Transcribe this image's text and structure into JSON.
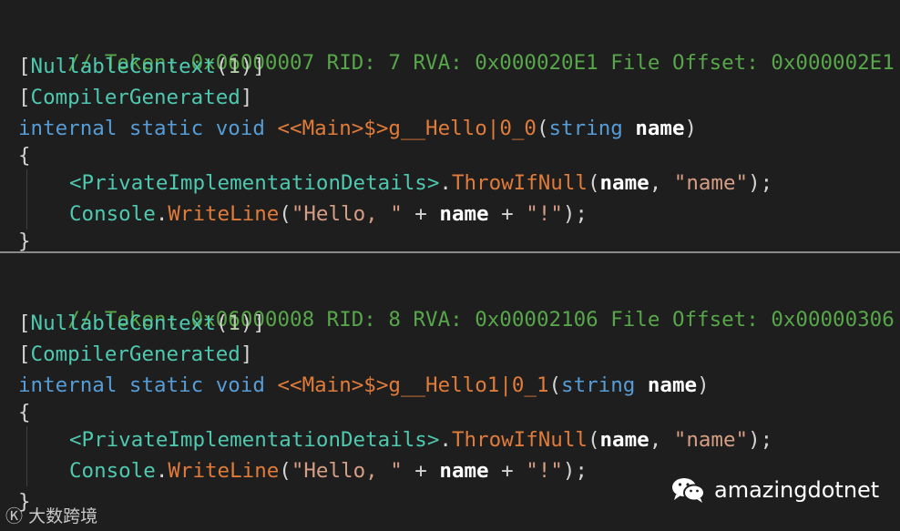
{
  "blocks": [
    {
      "comment": "// Token: 0x06000007 RID: 7 RVA: 0x000020E1 File Offset: 0x000002E1",
      "attr1_open": "[",
      "attr1_name": "NullableContext",
      "attr1_paren_open": "(",
      "attr1_arg": "1",
      "attr1_close": ")]",
      "attr2_open": "[",
      "attr2_name": "CompilerGenerated",
      "attr2_close": "]",
      "kw_internal": "internal",
      "kw_static": "static",
      "kw_void": "void",
      "method_name": "<<Main>$>g__Hello|0_0",
      "paren_open": "(",
      "param_type": "string",
      "param_name": "name",
      "paren_close": ")",
      "brace_open": "{",
      "line1_class": "<PrivateImplementationDetails>",
      "line1_dot": ".",
      "line1_method": "ThrowIfNull",
      "line1_open": "(",
      "line1_arg1": "name",
      "line1_comma": ", ",
      "line1_str": "\"name\"",
      "line1_close": ");",
      "line2_class": "Console",
      "line2_dot": ".",
      "line2_method": "WriteLine",
      "line2_open": "(",
      "line2_str1": "\"Hello, \"",
      "line2_plus1": " + ",
      "line2_var": "name",
      "line2_plus2": " + ",
      "line2_str2": "\"!\"",
      "line2_close": ");",
      "brace_close": "}"
    },
    {
      "comment": "// Token: 0x06000008 RID: 8 RVA: 0x00002106 File Offset: 0x00000306",
      "attr1_open": "[",
      "attr1_name": "NullableContext",
      "attr1_paren_open": "(",
      "attr1_arg": "1",
      "attr1_close": ")]",
      "attr2_open": "[",
      "attr2_name": "CompilerGenerated",
      "attr2_close": "]",
      "kw_internal": "internal",
      "kw_static": "static",
      "kw_void": "void",
      "method_name": "<<Main>$>g__Hello1|0_1",
      "paren_open": "(",
      "param_type": "string",
      "param_name": "name",
      "paren_close": ")",
      "brace_open": "{",
      "line1_class": "<PrivateImplementationDetails>",
      "line1_dot": ".",
      "line1_method": "ThrowIfNull",
      "line1_open": "(",
      "line1_arg1": "name",
      "line1_comma": ", ",
      "line1_str": "\"name\"",
      "line1_close": ");",
      "line2_class": "Console",
      "line2_dot": ".",
      "line2_method": "WriteLine",
      "line2_open": "(",
      "line2_str1": "\"Hello, \"",
      "line2_plus1": " + ",
      "line2_var": "name",
      "line2_plus2": " + ",
      "line2_str2": "\"!\"",
      "line2_close": ");",
      "brace_close": "}"
    }
  ],
  "watermarks": {
    "left_text": "大数跨境",
    "right_text": "amazingdotnet",
    "right_icon": "wechat-icon"
  },
  "colors": {
    "background": "#1e1e1e",
    "comment": "#57a64a",
    "keyword": "#569cd6",
    "type": "#4ec9b0",
    "method": "#e07b3a",
    "string": "#d69d85",
    "number": "#b5cea8",
    "divider": "#8a8a8a"
  }
}
